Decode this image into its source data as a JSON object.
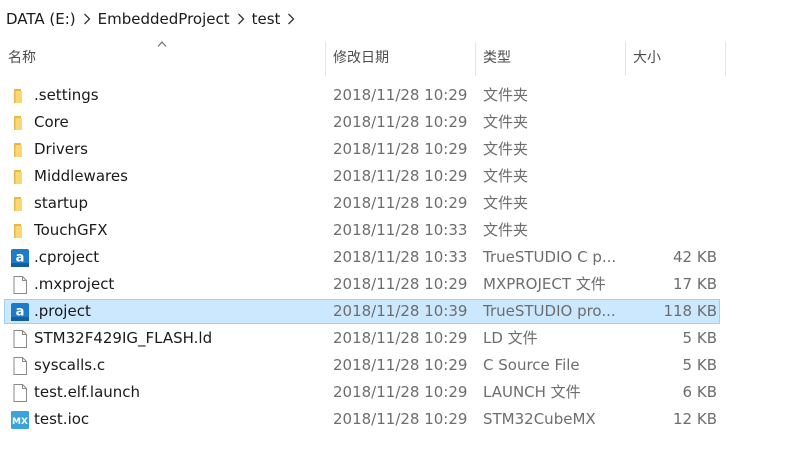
{
  "breadcrumb": {
    "items": [
      "DATA (E:)",
      "EmbeddedProject",
      "test"
    ]
  },
  "columns": {
    "name": "名称",
    "date": "修改日期",
    "type": "类型",
    "size": "大小"
  },
  "files": [
    {
      "name": ".settings",
      "date": "2018/11/28 10:29",
      "type": "文件夹",
      "size": "",
      "icon": "folder-icon"
    },
    {
      "name": "Core",
      "date": "2018/11/28 10:29",
      "type": "文件夹",
      "size": "",
      "icon": "folder-icon"
    },
    {
      "name": "Drivers",
      "date": "2018/11/28 10:29",
      "type": "文件夹",
      "size": "",
      "icon": "folder-icon"
    },
    {
      "name": "Middlewares",
      "date": "2018/11/28 10:29",
      "type": "文件夹",
      "size": "",
      "icon": "folder-icon"
    },
    {
      "name": "startup",
      "date": "2018/11/28 10:29",
      "type": "文件夹",
      "size": "",
      "icon": "folder-icon"
    },
    {
      "name": "TouchGFX",
      "date": "2018/11/28 10:33",
      "type": "文件夹",
      "size": "",
      "icon": "folder-icon"
    },
    {
      "name": ".cproject",
      "date": "2018/11/28 10:33",
      "type": "TrueSTUDIO C p...",
      "size": "42 KB",
      "icon": "truestudio-icon"
    },
    {
      "name": ".mxproject",
      "date": "2018/11/28 10:29",
      "type": "MXPROJECT 文件",
      "size": "17 KB",
      "icon": "file-icon"
    },
    {
      "name": ".project",
      "date": "2018/11/28 10:39",
      "type": "TrueSTUDIO pro...",
      "size": "118 KB",
      "icon": "truestudio-icon",
      "selected": true
    },
    {
      "name": "STM32F429IG_FLASH.ld",
      "date": "2018/11/28 10:29",
      "type": "LD 文件",
      "size": "5 KB",
      "icon": "file-icon"
    },
    {
      "name": "syscalls.c",
      "date": "2018/11/28 10:29",
      "type": "C Source File",
      "size": "5 KB",
      "icon": "file-icon"
    },
    {
      "name": "test.elf.launch",
      "date": "2018/11/28 10:29",
      "type": "LAUNCH 文件",
      "size": "6 KB",
      "icon": "file-icon"
    },
    {
      "name": "test.ioc",
      "date": "2018/11/28 10:29",
      "type": "STM32CubeMX",
      "size": "12 KB",
      "icon": "stm32cubemx-icon"
    }
  ],
  "icon_text": {
    "truestudio": "a",
    "stm32cubemx": "MX"
  },
  "colors": {
    "selection_bg": "#cce8ff",
    "selection_border": "#99d1ff",
    "folder": "#f8d775",
    "truestudio": "#1f7ac8",
    "stm32cubemx": "#3aa3d9"
  }
}
